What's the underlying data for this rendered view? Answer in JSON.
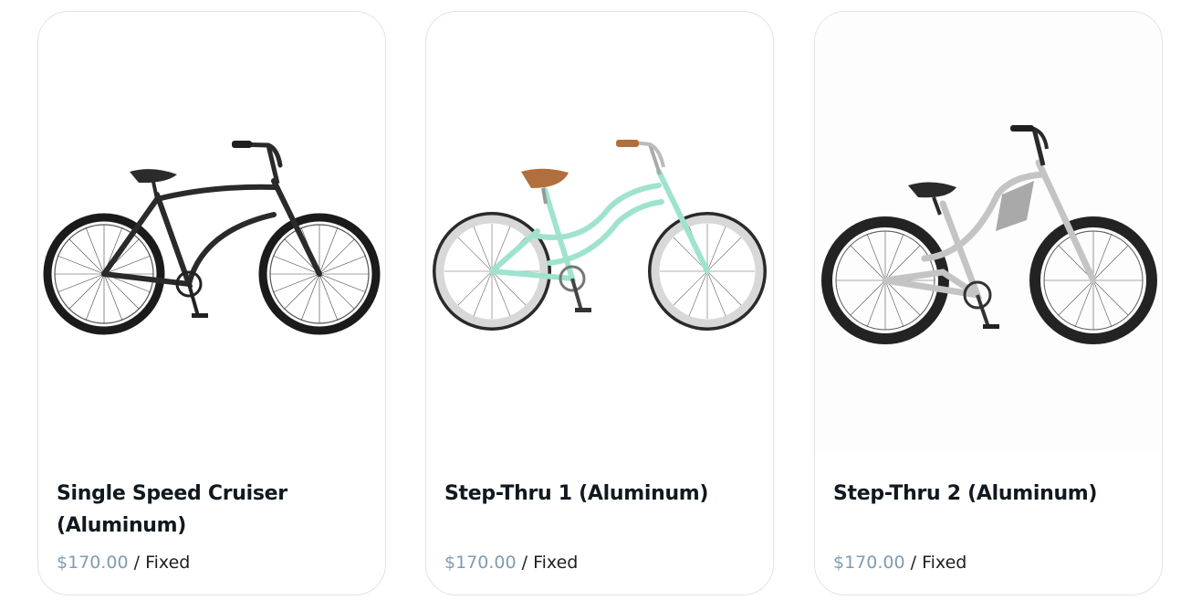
{
  "colors": {
    "title": "#11181f",
    "price": "#7f9cb1",
    "unit": "#1e1e1e",
    "card_border": "#e3e3e3"
  },
  "products": [
    {
      "title": "Single Speed Cruiser (Aluminum)",
      "price": "$170.00",
      "separator": "/",
      "unit": "Fixed",
      "bike_color": "matte-black"
    },
    {
      "title": "Step-Thru 1 (Aluminum)",
      "price": "$170.00",
      "separator": "/",
      "unit": "Fixed",
      "bike_color": "mint-green"
    },
    {
      "title": "Step-Thru 2 (Aluminum)",
      "price": "$170.00",
      "separator": "/",
      "unit": "Fixed",
      "bike_color": "silver"
    }
  ]
}
